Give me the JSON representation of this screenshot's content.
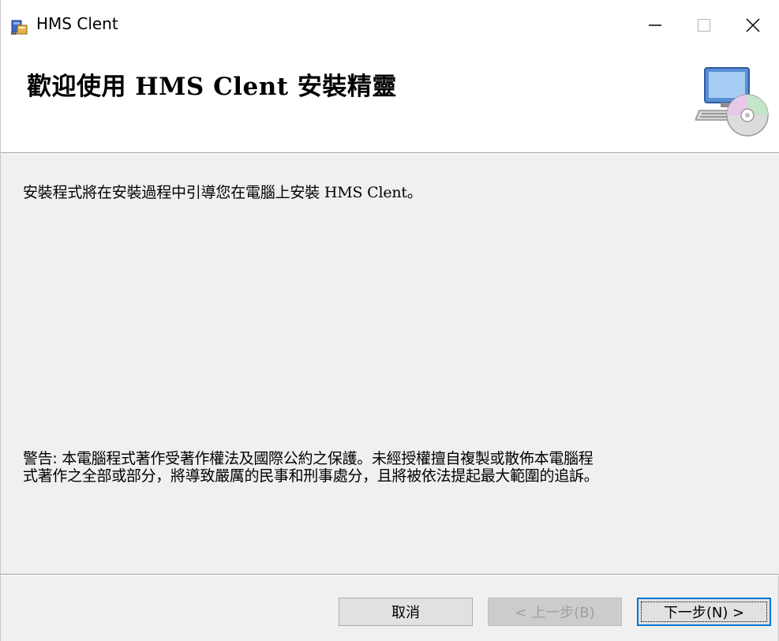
{
  "window": {
    "title": "HMS Clent",
    "controls": {
      "minimize_icon": "minimize-icon",
      "maximize_icon": "maximize-icon",
      "close_icon": "close-icon"
    }
  },
  "banner": {
    "title": "歡迎使用 HMS Clent 安裝精靈",
    "image_icon": "computer-cd-icon"
  },
  "body": {
    "intro": "安裝程式將在安裝過程中引導您在電腦上安裝 HMS Clent。",
    "warning_line1": "警告: 本電腦程式著作受著作權法及國際公約之保護。未經授權擅自複製或散佈本電腦程",
    "warning_line2": "式著作之全部或部分，將導致嚴厲的民事和刑事處分，且將被依法提起最大範圍的追訴。"
  },
  "buttons": {
    "cancel": "取消",
    "back": "< 上一步(B)",
    "next": "下一步(N) >"
  },
  "colors": {
    "accent": "#0078d7",
    "disabled_text": "#a0a0a0",
    "window_bg": "#f0f0f0"
  }
}
